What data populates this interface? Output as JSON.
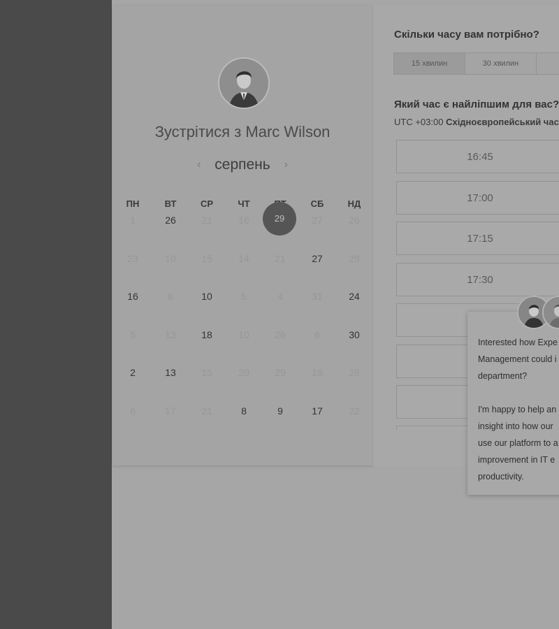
{
  "booking": {
    "meet_title": "Зустрітися з Marc Wilson",
    "month": "серпень",
    "prev_icon": "chevron-left-icon",
    "next_icon": "chevron-right-icon"
  },
  "calendar": {
    "weekdays": [
      "ПН",
      "ВТ",
      "СР",
      "ЧТ",
      "ПТ",
      "СБ",
      "НД"
    ],
    "selected_day": "29",
    "rows": [
      [
        "1",
        "26",
        "21",
        "16",
        "29",
        "27",
        "26"
      ],
      [
        "23",
        "10",
        "15",
        "14",
        "21",
        "27",
        "29"
      ],
      [
        "16",
        "6",
        "10",
        "5",
        "4",
        "31",
        "24"
      ],
      [
        "5",
        "13",
        "18",
        "10",
        "26",
        "6",
        "30"
      ],
      [
        "2",
        "13",
        "15",
        "20",
        "29",
        "18",
        "28"
      ],
      [
        "6",
        "17",
        "21",
        "8",
        "9",
        "17",
        "22"
      ]
    ],
    "available": [
      [
        false,
        true,
        false,
        false,
        false,
        false,
        false
      ],
      [
        false,
        false,
        false,
        false,
        false,
        true,
        false
      ],
      [
        true,
        false,
        true,
        false,
        false,
        false,
        true
      ],
      [
        false,
        false,
        true,
        false,
        false,
        false,
        true
      ],
      [
        true,
        true,
        false,
        false,
        false,
        false,
        false
      ],
      [
        false,
        false,
        false,
        true,
        true,
        true,
        false
      ]
    ]
  },
  "duration": {
    "question": "Скільки часу вам потрібно?",
    "options": [
      "15 хвилин",
      "30 хвилин",
      ""
    ]
  },
  "timeslots": {
    "question": "Який час є найліпшим для вас?",
    "timezone_offset": "UTC +03:00",
    "timezone_name": "Східноєвропейський час",
    "slots": [
      "16:45",
      "17:00",
      "17:15",
      "17:30",
      "",
      "",
      "",
      ""
    ]
  },
  "chat_popup": {
    "lines": [
      "Interested how Expe",
      "Management could i",
      "department?",
      "",
      "I'm happy to help an",
      "insight into how our",
      "use our platform to a",
      "improvement in IT e",
      "productivity."
    ]
  },
  "colors": {
    "sidebar": "#4a4a4a",
    "overlay": "#a6a6a6",
    "selected_day_bg": "#555555"
  }
}
